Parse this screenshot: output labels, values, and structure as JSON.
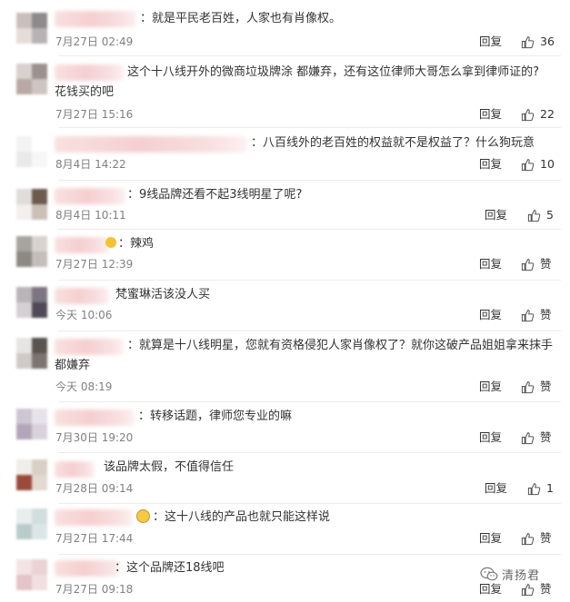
{
  "reply_label": "回复",
  "comments": [
    {
      "text": "：就是平民老百姓，人家也有肖像权。",
      "date": "7月27日 02:49",
      "likes": "36"
    },
    {
      "text": "这个十八线开外的微商垃圾牌涂    都嫌弃，还有这位律师大哥怎么拿到律师证的?",
      "text2": "花钱买的吧",
      "date": "7月27日 15:16",
      "likes": "22"
    },
    {
      "text": "：八百线外的老百姓的权益就不是权益了？什么狗玩意",
      "date": "8月4日 14:22",
      "likes": "10"
    },
    {
      "text": "：9线品牌还看不起3线明星了呢?",
      "date": "8月4日 10:11",
      "likes": "5"
    },
    {
      "text": "：辣鸡",
      "date": "7月27日 12:39",
      "likes": "赞"
    },
    {
      "text": "梵蜜琳活该没人买",
      "date": "今天 10:06",
      "likes": "赞"
    },
    {
      "text": "：就算是十八线明星，您就有资格侵犯人家肖像权了？就你这破产品姐姐拿来抹手",
      "text2": "都嫌弃",
      "date": "今天 08:19",
      "likes": "赞"
    },
    {
      "text": "：转移话题，律师您专业的嘛",
      "date": "7月30日 19:20",
      "likes": "赞"
    },
    {
      "text": "该品牌太假，不值得信任",
      "date": "7月28日 09:14",
      "likes": "1"
    },
    {
      "text": "：这十八线的产品也就只能这样说",
      "date": "7月27日 17:44",
      "likes": "赞"
    },
    {
      "text": "：这个品牌还18线吧",
      "date": "7月27日 09:18",
      "likes": "赞"
    }
  ],
  "watermark": {
    "text": "清扬君",
    "icon": "wechat-icon"
  },
  "colors": {
    "text": "#333333",
    "meta": "#808080",
    "separator": "#ececec",
    "blur_pink": "#f5cfd0"
  }
}
